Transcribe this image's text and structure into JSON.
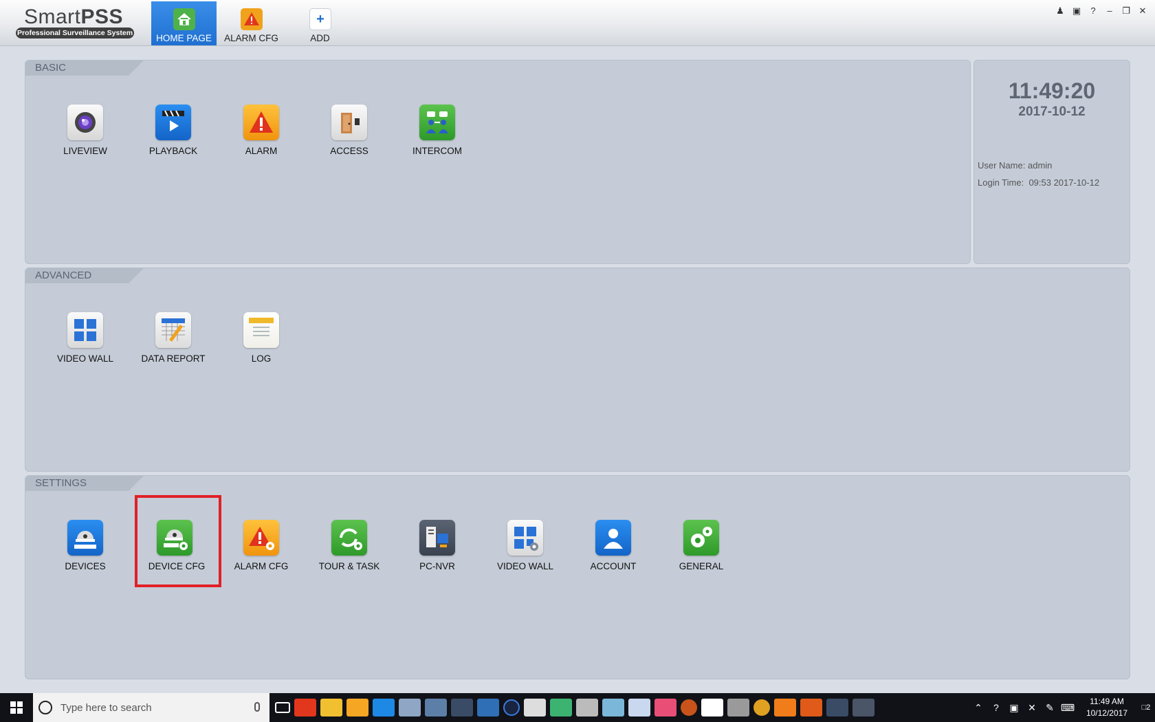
{
  "app": {
    "logo_prefix": "Smart",
    "logo_bold": "PSS",
    "logo_sub": "Professional Surveillance System"
  },
  "nav_tabs": [
    {
      "label": "HOME PAGE",
      "icon": "home-icon",
      "active": true
    },
    {
      "label": "ALARM CFG",
      "icon": "alarm-cfg-icon",
      "active": false
    },
    {
      "label": "ADD",
      "icon": "plus-icon",
      "active": false
    }
  ],
  "window_controls": [
    "user-icon",
    "lock-icon",
    "help-icon",
    "minimize-icon",
    "restore-icon",
    "close-icon"
  ],
  "sections": {
    "basic": {
      "title": "BASIC",
      "items": [
        {
          "label": "LIVEVIEW",
          "icon": "camera-lens-icon"
        },
        {
          "label": "PLAYBACK",
          "icon": "clapperboard-play-icon"
        },
        {
          "label": "ALARM",
          "icon": "warning-triangle-icon"
        },
        {
          "label": "ACCESS",
          "icon": "door-icon"
        },
        {
          "label": "INTERCOM",
          "icon": "intercom-people-icon"
        }
      ]
    },
    "advanced": {
      "title": "ADVANCED",
      "items": [
        {
          "label": "VIDEO WALL",
          "icon": "video-wall-icon"
        },
        {
          "label": "DATA REPORT",
          "icon": "calendar-pencil-icon"
        },
        {
          "label": "LOG",
          "icon": "notepad-icon"
        }
      ]
    },
    "settings": {
      "title": "SETTINGS",
      "items": [
        {
          "label": "DEVICES",
          "icon": "dome-camera-icon"
        },
        {
          "label": "DEVICE CFG",
          "icon": "dome-camera-gear-icon",
          "highlighted": true
        },
        {
          "label": "ALARM CFG",
          "icon": "alarm-gear-icon"
        },
        {
          "label": "TOUR & TASK",
          "icon": "cycle-gear-icon"
        },
        {
          "label": "PC-NVR",
          "icon": "nvr-icon"
        },
        {
          "label": "VIDEO WALL",
          "icon": "video-wall-gear-icon"
        },
        {
          "label": "ACCOUNT",
          "icon": "person-icon"
        },
        {
          "label": "GENERAL",
          "icon": "gears-icon"
        }
      ]
    }
  },
  "info": {
    "time": "11:49:20",
    "date": "2017-10-12",
    "user_label": "User Name:",
    "user_value": "admin",
    "login_label": "Login Time:",
    "login_value": "09:53 2017-10-12"
  },
  "taskbar": {
    "search_placeholder": "Type here to search",
    "clock_time": "11:49 AM",
    "clock_date": "10/12/2017",
    "notification_count": "2"
  },
  "colors": {
    "accent": "#1f6fd1",
    "panel": "#c5ccd7",
    "highlight": "#e11f26"
  }
}
